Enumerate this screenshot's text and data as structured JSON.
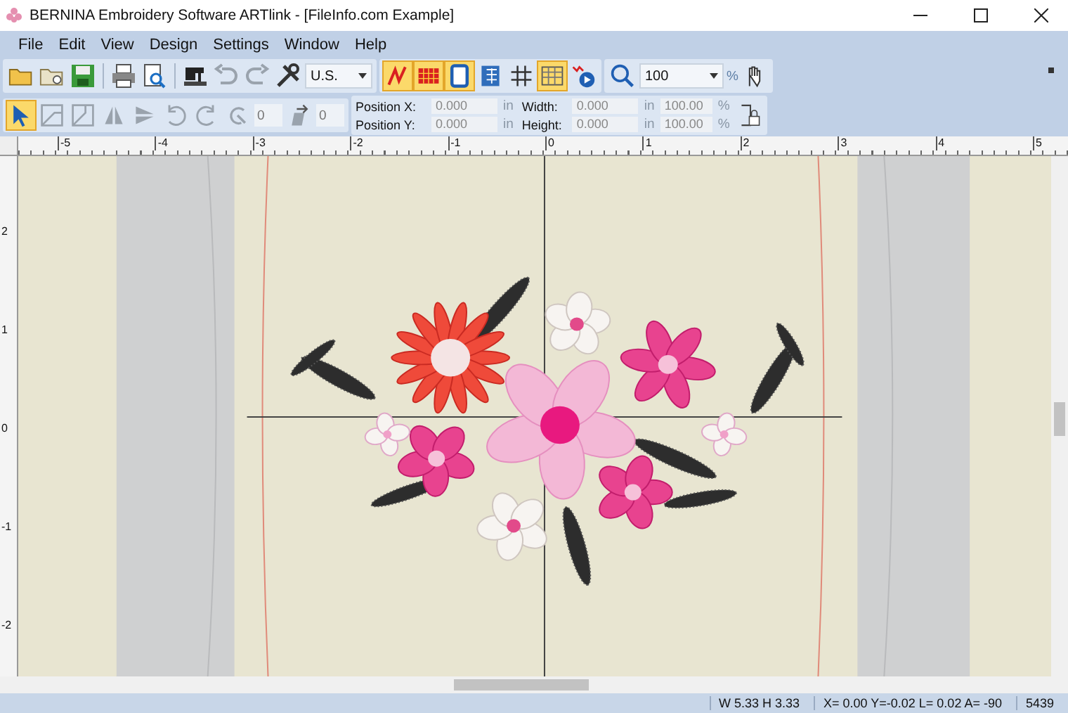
{
  "window": {
    "title": "BERNINA Embroidery Software ARTlink - [FileInfo.com Example]"
  },
  "menu": [
    "File",
    "Edit",
    "View",
    "Design",
    "Settings",
    "Window",
    "Help"
  ],
  "toolbar": {
    "units": "U.S.",
    "view_toggles": [
      {
        "kind": "zigzag",
        "on": true
      },
      {
        "kind": "fill",
        "on": true
      },
      {
        "kind": "hoop",
        "on": true
      },
      {
        "kind": "grid-panel",
        "on": false
      },
      {
        "kind": "grid",
        "on": false
      },
      {
        "kind": "table",
        "on": true
      }
    ],
    "zoom": "100",
    "zoom_unit": "%"
  },
  "transform_bar": {
    "select_tool_on": true,
    "rotate_value": "0",
    "slant_value": "0",
    "fields": [
      {
        "label": "Position X:",
        "value": "0.000",
        "unit": "in"
      },
      {
        "label": "Position Y:",
        "value": "0.000",
        "unit": "in"
      },
      {
        "label": "Width:",
        "value": "0.000",
        "unit": "in",
        "scale": "100.00",
        "scale_unit": "%"
      },
      {
        "label": "Height:",
        "value": "0.000",
        "unit": "in",
        "scale": "100.00",
        "scale_unit": "%"
      }
    ]
  },
  "ruler": {
    "horizontal": [
      "-5",
      "-4",
      "-3",
      "-2",
      "-1",
      "0",
      "1",
      "2",
      "3",
      "4",
      "5"
    ],
    "vertical": [
      "2",
      "1",
      "0",
      "-1",
      "-2"
    ]
  },
  "status_bar": {
    "size": "W 5.33 H 3.33",
    "position": "X= 0.00 Y=-0.02 L= 0.02 A= -90",
    "stitches": "5439"
  }
}
